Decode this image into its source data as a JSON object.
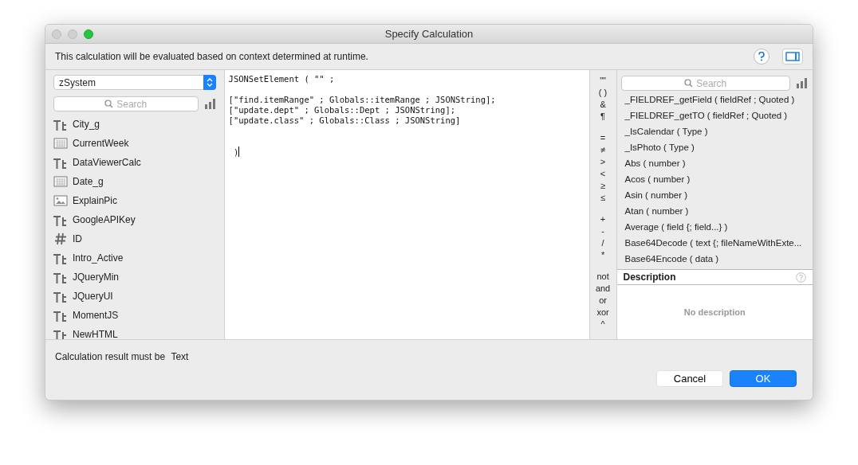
{
  "window": {
    "title": "Specify Calculation"
  },
  "info_text": "This calculation will be evaluated based on context determined at runtime.",
  "table_select": {
    "value": "zSystem"
  },
  "fields_search": {
    "placeholder": "Search"
  },
  "fields": [
    {
      "name": "City_g",
      "kind": "text"
    },
    {
      "name": "CurrentWeek",
      "kind": "date"
    },
    {
      "name": "DataViewerCalc",
      "kind": "text"
    },
    {
      "name": "Date_g",
      "kind": "date"
    },
    {
      "name": "ExplainPic",
      "kind": "container"
    },
    {
      "name": "GoogleAPIKey",
      "kind": "text"
    },
    {
      "name": "ID",
      "kind": "number"
    },
    {
      "name": "Intro_Active",
      "kind": "text"
    },
    {
      "name": "JQueryMin",
      "kind": "text"
    },
    {
      "name": "JQueryUI",
      "kind": "text"
    },
    {
      "name": "MomentJS",
      "kind": "text"
    },
    {
      "name": "NewHTML",
      "kind": "text"
    }
  ],
  "formula": "JSONSetElement ( \"\" ;\n\n[\"find.itemRange\" ; Globals::itemRange ; JSONString];\n[\"update.dept\" ; Globals::Dept ; JSONString];\n[\"update.class\" ; Globals::Class ; JSONString]\n\n\n )",
  "operator_groups": [
    [
      "\"\"",
      "( )",
      "&",
      "¶"
    ],
    [
      "=",
      "≠",
      ">",
      "<",
      "≥",
      "≤"
    ],
    [
      "+",
      "-",
      "/",
      "*"
    ],
    [
      "not",
      "and",
      "or",
      "xor",
      "^"
    ]
  ],
  "functions_search": {
    "placeholder": "Search"
  },
  "functions": [
    "_FIELDREF_getField ( fieldRef ; Quoted )",
    "_FIELDREF_getTO ( fieldRef ; Quoted )",
    "_IsCalendar ( Type )",
    "_IsPhoto ( Type )",
    "Abs ( number )",
    "Acos ( number )",
    "Asin ( number )",
    "Atan ( number )",
    "Average ( field {; field...} )",
    "Base64Decode ( text {; fileNameWithExte...",
    "Base64Encode ( data )"
  ],
  "description": {
    "title": "Description",
    "text": "No description"
  },
  "result_label": "Calculation result must be",
  "result_type": "Text",
  "buttons": [
    {
      "label": "Cancel",
      "default": false
    },
    {
      "label": "OK",
      "default": true
    }
  ]
}
